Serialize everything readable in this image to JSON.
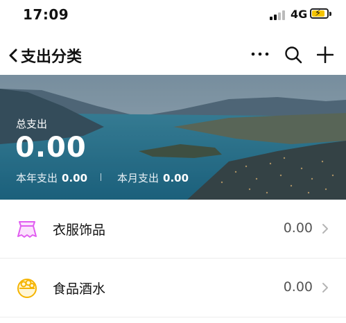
{
  "status_bar": {
    "time": "17:09",
    "network": "4G"
  },
  "nav": {
    "title": "支出分类"
  },
  "hero": {
    "label": "总支出",
    "amount": "0.00",
    "year_label": "本年支出",
    "year_value": "0.00",
    "month_label": "本月支出",
    "month_value": "0.00"
  },
  "categories": [
    {
      "label": "衣服饰品",
      "amount": "0.00",
      "icon": "clothing-icon",
      "color": "#e05cf0"
    },
    {
      "label": "食品酒水",
      "amount": "0.00",
      "icon": "food-icon",
      "color": "#f5b400"
    }
  ]
}
